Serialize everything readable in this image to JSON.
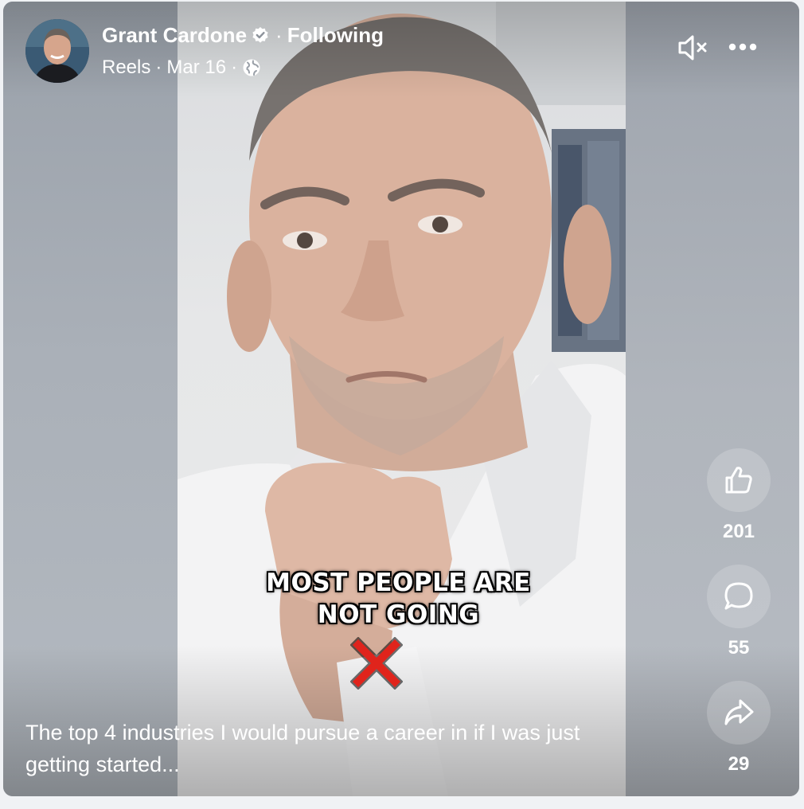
{
  "post": {
    "author": "Grant Cardone",
    "verified_icon": "verified-badge-icon",
    "separator": "·",
    "follow_status": "Following",
    "source": "Reels",
    "date_separator": "·",
    "date": "Mar 16",
    "audience_separator": "·",
    "audience_icon": "globe-icon"
  },
  "video": {
    "overlay_line1": "MOST PEOPLE ARE",
    "overlay_line2": "NOT GOING",
    "overlay_mark_icon": "red-x-icon"
  },
  "controls": {
    "mute_icon": "speaker-muted-icon",
    "more_icon": "more-options-icon"
  },
  "actions": {
    "like": {
      "icon": "thumbs-up-icon",
      "count": "201"
    },
    "comment": {
      "icon": "comment-bubble-icon",
      "count": "55"
    },
    "share": {
      "icon": "share-arrow-icon",
      "count": "29"
    }
  },
  "caption": "The top 4 industries I would pursue a career in if I was just getting started...",
  "colors": {
    "text": "#ffffff",
    "overlay_x": "#e0241c"
  }
}
